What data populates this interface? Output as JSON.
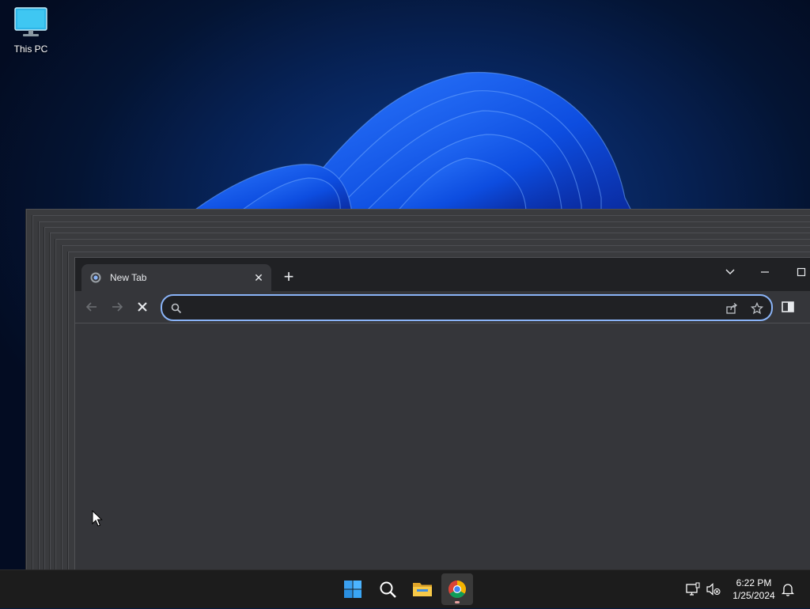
{
  "desktop": {
    "icons": [
      {
        "label": "This PC",
        "icon": "monitor-icon"
      }
    ]
  },
  "browser": {
    "tab": {
      "title": "New Tab",
      "favicon": "chrome-newtab-icon"
    },
    "address_bar": {
      "value": "",
      "placeholder": ""
    },
    "window_controls": [
      "tab-search",
      "minimize",
      "maximize"
    ],
    "nav": [
      "back",
      "forward",
      "stop"
    ],
    "accent": "#8ab4f8"
  },
  "taskbar": {
    "apps": [
      {
        "name": "Start",
        "icon": "windows-start-icon"
      },
      {
        "name": "Search",
        "icon": "search-icon"
      },
      {
        "name": "File Explorer",
        "icon": "folder-icon"
      },
      {
        "name": "Google Chrome",
        "icon": "chrome-icon",
        "active": true
      }
    ],
    "clock": {
      "time": "6:22 PM",
      "date": "1/25/2024"
    }
  }
}
